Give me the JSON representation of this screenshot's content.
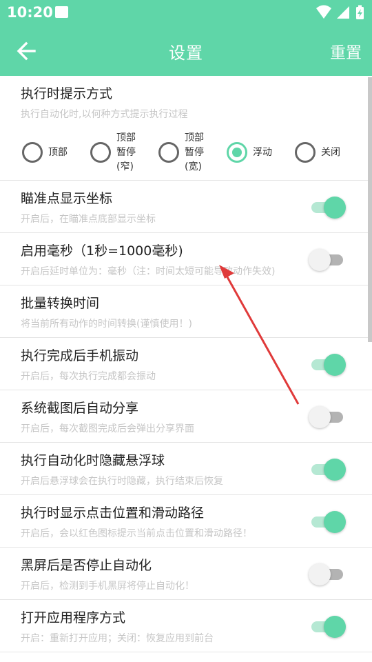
{
  "status_bar": {
    "time": "10:20"
  },
  "app_bar": {
    "title": "设置",
    "reset_label": "重置"
  },
  "colors": {
    "accent": "#5fd6a8",
    "annotation_arrow": "#e03a3a"
  },
  "notify_mode": {
    "title": "执行时提示方式",
    "description": "执行自动化时,以何种方式提示执行过程",
    "options": [
      {
        "lines": [
          "顶部"
        ],
        "checked": false
      },
      {
        "lines": [
          "顶部",
          "暂停",
          "(窄)"
        ],
        "checked": false
      },
      {
        "lines": [
          "顶部",
          "暂停",
          "(宽)"
        ],
        "checked": false
      },
      {
        "lines": [
          "浮动"
        ],
        "checked": true
      },
      {
        "lines": [
          "关闭"
        ],
        "checked": false
      }
    ]
  },
  "settings": [
    {
      "title": "瞄准点显示坐标",
      "description": "开启后，在瞄准点底部显示坐标",
      "toggle": true
    },
    {
      "title": "启用毫秒（1秒=1000毫秒)",
      "description": "开启后延时单位为：毫秒（注：时间太短可能导致动作失效)",
      "toggle": false
    },
    {
      "title": "批量转换时间",
      "description": "将当前所有动作的时间转换(谨慎使用！)",
      "toggle": null
    },
    {
      "title": "执行完成后手机振动",
      "description": "开启后，每次执行完成都会振动",
      "toggle": true
    },
    {
      "title": "系统截图后自动分享",
      "description": "开启后，每次截图完成后会弹出分享界面",
      "toggle": false
    },
    {
      "title": "执行自动化时隐藏悬浮球",
      "description": "开启后悬浮球会在执行时隐藏，执行结束后恢复",
      "toggle": true
    },
    {
      "title": "执行时显示点击位置和滑动路径",
      "description": "开启后，会以红色图标提示当前点击位置和滑动路径！",
      "toggle": true
    },
    {
      "title": "黑屏后是否停止自动化",
      "description": "开启后，检测到手机黑屏将停止自动化！",
      "toggle": false
    },
    {
      "title": "打开应用程序方式",
      "description": "开启：重新打开应用；关闭：恢复应用到前台",
      "toggle": true
    }
  ]
}
